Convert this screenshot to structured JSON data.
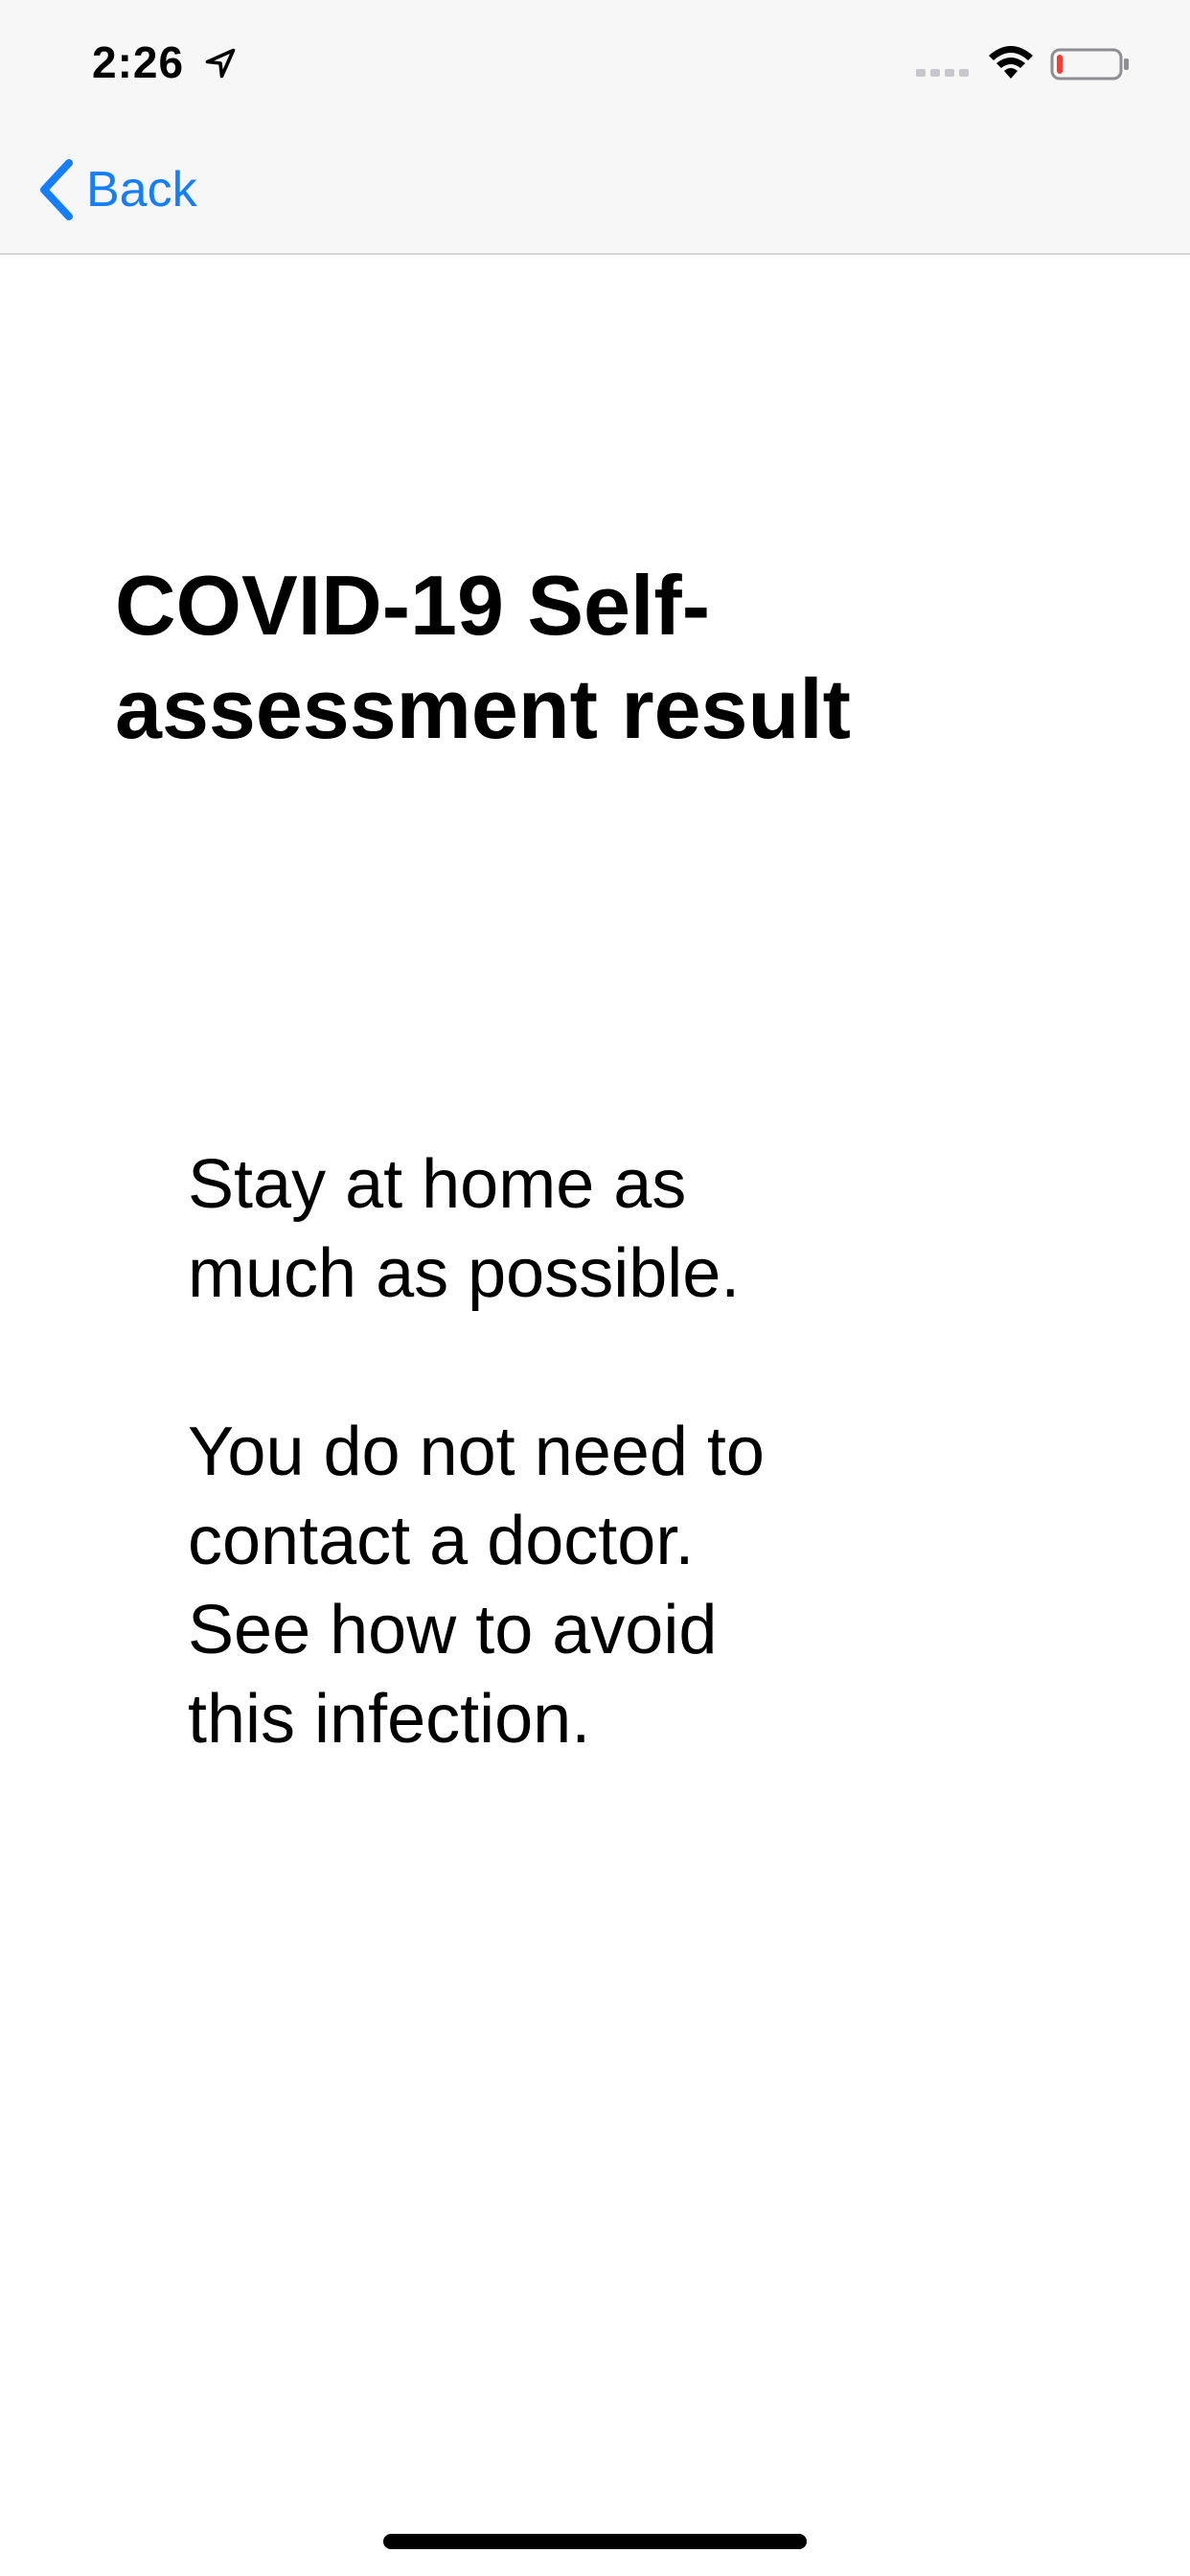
{
  "status_bar": {
    "time": "2:26",
    "icons": [
      "location-arrow-icon",
      "cellular-signal-icon",
      "wifi-icon",
      "battery-icon"
    ],
    "battery_level": 0.1,
    "battery_color": "#ff3b30"
  },
  "nav": {
    "back_label": "Back",
    "accent_color": "#147efb"
  },
  "main": {
    "title": "COVID-19 Self-\nassessment result",
    "result_text": "Stay at home as\nmuch as possible.\n\nYou do not need to\ncontact a doctor.\nSee how to avoid\nthis infection."
  }
}
